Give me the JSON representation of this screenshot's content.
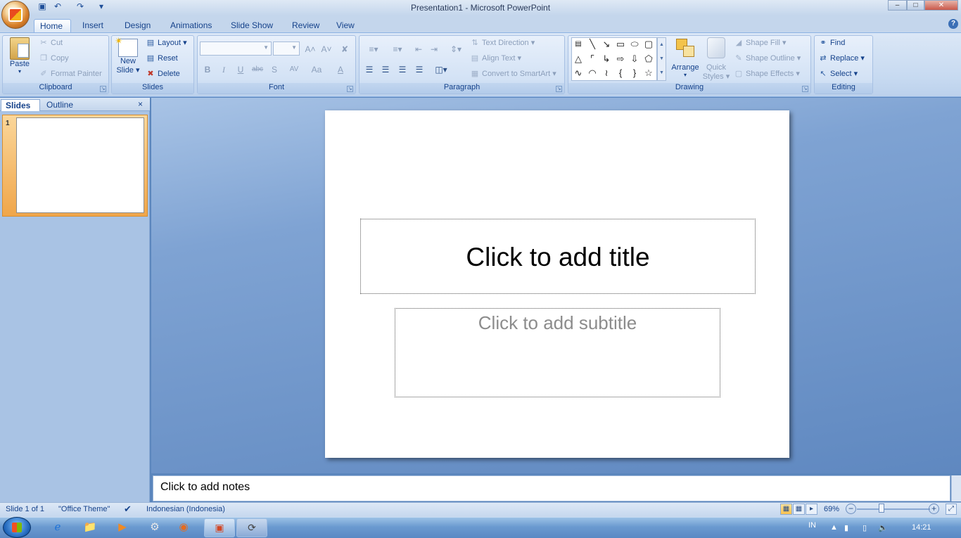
{
  "window": {
    "title": "Presentation1 - Microsoft PowerPoint"
  },
  "quick_access": {
    "save": "💾",
    "undo": "↶",
    "redo": "↷",
    "customize": "▾"
  },
  "window_controls": {
    "minimize": "–",
    "maximize": "□",
    "close": "✕"
  },
  "tabs": [
    {
      "label": "Home",
      "active": true
    },
    {
      "label": "Insert"
    },
    {
      "label": "Design"
    },
    {
      "label": "Animations"
    },
    {
      "label": "Slide Show"
    },
    {
      "label": "Review"
    },
    {
      "label": "View"
    }
  ],
  "help": "?",
  "ribbon": {
    "clipboard": {
      "label": "Clipboard",
      "paste": "Paste",
      "cut": "Cut",
      "copy": "Copy",
      "format_painter": "Format Painter"
    },
    "slides": {
      "label": "Slides",
      "new_slide_line1": "New",
      "new_slide_line2": "Slide ▾",
      "layout": "Layout ▾",
      "reset": "Reset",
      "delete": "Delete"
    },
    "font": {
      "label": "Font",
      "bold": "B",
      "italic": "I",
      "underline": "U",
      "strike": "abc",
      "shadow": "S",
      "spacing": "AV",
      "case": "Aa",
      "color": "A",
      "grow": "A˄",
      "shrink": "A˅",
      "clear": "✘"
    },
    "paragraph": {
      "label": "Paragraph",
      "text_direction": "Text Direction ▾",
      "align_text": "Align Text ▾",
      "convert_smartart": "Convert to SmartArt ▾"
    },
    "drawing": {
      "label": "Drawing",
      "arrange": "Arrange",
      "quick_styles_line1": "Quick",
      "quick_styles_line2": "Styles ▾",
      "shape_fill": "Shape Fill ▾",
      "shape_outline": "Shape Outline ▾",
      "shape_effects": "Shape Effects ▾"
    },
    "editing": {
      "label": "Editing",
      "find": "Find",
      "replace": "Replace ▾",
      "select": "Select ▾"
    }
  },
  "pane": {
    "tab_slides": "Slides",
    "tab_outline": "Outline",
    "close": "×",
    "thumb_number": "1"
  },
  "slide": {
    "title_placeholder": "Click to add title",
    "subtitle_placeholder": "Click to add subtitle"
  },
  "notes": {
    "placeholder": "Click to add notes"
  },
  "status": {
    "slide_info": "Slide 1 of 1",
    "theme": "\"Office Theme\"",
    "language": "Indonesian (Indonesia)",
    "zoom": "69%",
    "zoom_out": "−",
    "zoom_in": "+",
    "zoom_value": 69
  },
  "taskbar": {
    "lang": "IN",
    "time": "14:21"
  }
}
